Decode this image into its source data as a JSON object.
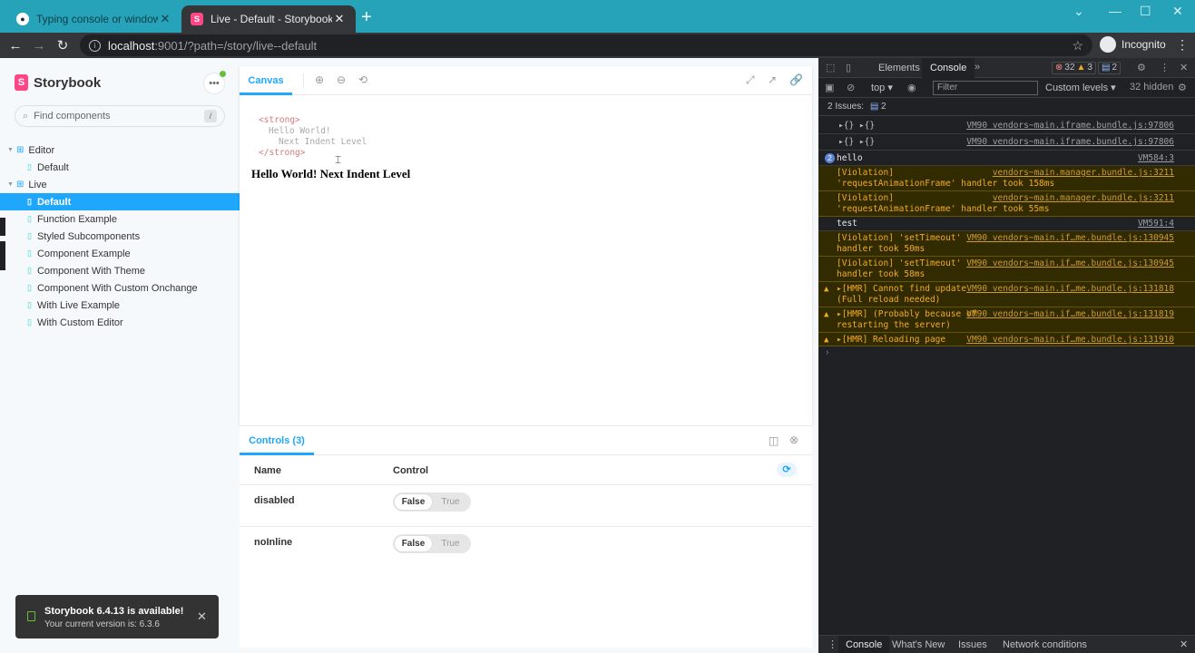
{
  "browser": {
    "tabs": [
      {
        "title": "Typing console or window crashe",
        "active": false
      },
      {
        "title": "Live - Default - Storybook",
        "active": true
      }
    ],
    "url_host": "localhost",
    "url_path": ":9001/?path=/story/live--default",
    "profile": "Incognito"
  },
  "storybook": {
    "brand": "Storybook",
    "search_placeholder": "Find components",
    "search_shortcut": "/",
    "tree": [
      {
        "type": "group",
        "label": "Editor"
      },
      {
        "type": "story",
        "label": "Default",
        "selected": false
      },
      {
        "type": "group",
        "label": "Live"
      },
      {
        "type": "story",
        "label": "Default",
        "selected": true
      },
      {
        "type": "story",
        "label": "Function Example",
        "selected": false
      },
      {
        "type": "story",
        "label": "Styled Subcomponents",
        "selected": false
      },
      {
        "type": "story",
        "label": "Component Example",
        "selected": false
      },
      {
        "type": "story",
        "label": "Component With Theme",
        "selected": false
      },
      {
        "type": "story",
        "label": "Component With Custom Onchange",
        "selected": false
      },
      {
        "type": "story",
        "label": "With Live Example",
        "selected": false
      },
      {
        "type": "story",
        "label": "With Custom Editor",
        "selected": false
      }
    ],
    "toast": {
      "title": "Storybook 6.4.13 is available!",
      "subtitle": "Your current version is: 6.3.6"
    }
  },
  "preview": {
    "tab_label": "Canvas",
    "code_lines": [
      "<strong>",
      "Hello World!",
      "Next Indent Level",
      "</strong>"
    ],
    "rendered_text": "Hello World! Next Indent Level"
  },
  "controls": {
    "tab_label": "Controls (3)",
    "col_name": "Name",
    "col_control": "Control",
    "rows": [
      {
        "name": "disabled",
        "off_label": "False",
        "on_label": "True",
        "value": false
      },
      {
        "name": "noInline",
        "off_label": "False",
        "on_label": "True",
        "value": false
      }
    ]
  },
  "devtools": {
    "tabs": [
      "Elements",
      "Console"
    ],
    "active_tab": "Console",
    "error_count": "32",
    "warning_count": "3",
    "message_count": "2",
    "context": "top",
    "filter_placeholder": "Filter",
    "levels": "Custom levels",
    "hidden": "32 hidden",
    "issues_label": "2 Issues:",
    "issues_count": "2",
    "logs": [
      {
        "kind": "object",
        "text": "▸{} ▸{}",
        "source": "VM90 vendors~main.iframe.bundle.js:97806"
      },
      {
        "kind": "object",
        "text": "▸{} ▸{}",
        "source": "VM90 vendors~main.iframe.bundle.js:97806"
      },
      {
        "kind": "info",
        "count": "2",
        "text": "hello",
        "source": "VM584:3"
      },
      {
        "kind": "violation",
        "text": "[Violation]\n'requestAnimationFrame' handler took 158ms",
        "source": "vendors~main.manager.bundle.js:3211"
      },
      {
        "kind": "violation",
        "text": "[Violation]\n'requestAnimationFrame' handler took 55ms",
        "source": "vendors~main.manager.bundle.js:3211"
      },
      {
        "kind": "info",
        "text": "test",
        "source": "VM591:4"
      },
      {
        "kind": "violation",
        "text": "[Violation] 'setTimeout'\nhandler took 50ms",
        "source": "VM90 vendors~main.if…me.bundle.js:130945"
      },
      {
        "kind": "violation",
        "text": "[Violation] 'setTimeout'\nhandler took 58ms",
        "source": "VM90 vendors~main.if…me.bundle.js:130945"
      },
      {
        "kind": "warn",
        "text": "▸[HMR] Cannot find update\n(Full reload needed)",
        "source": "VM90 vendors~main.if…me.bundle.js:131818"
      },
      {
        "kind": "warn",
        "text": "▸[HMR] (Probably because of\nrestarting the server)",
        "source": "VM90 vendors~main.if…me.bundle.js:131819"
      },
      {
        "kind": "warn",
        "text": "▸[HMR] Reloading page",
        "source": "VM90 vendors~main.if…me.bundle.js:131910"
      }
    ],
    "drawer_tabs": [
      "Console",
      "What's New",
      "Issues",
      "Network conditions"
    ]
  },
  "colors": {
    "storybook_blue": "#1ea7fd",
    "storybook_pink": "#ff4785",
    "tab_strip": "#26a3b9",
    "devtools_bg": "#202124"
  }
}
